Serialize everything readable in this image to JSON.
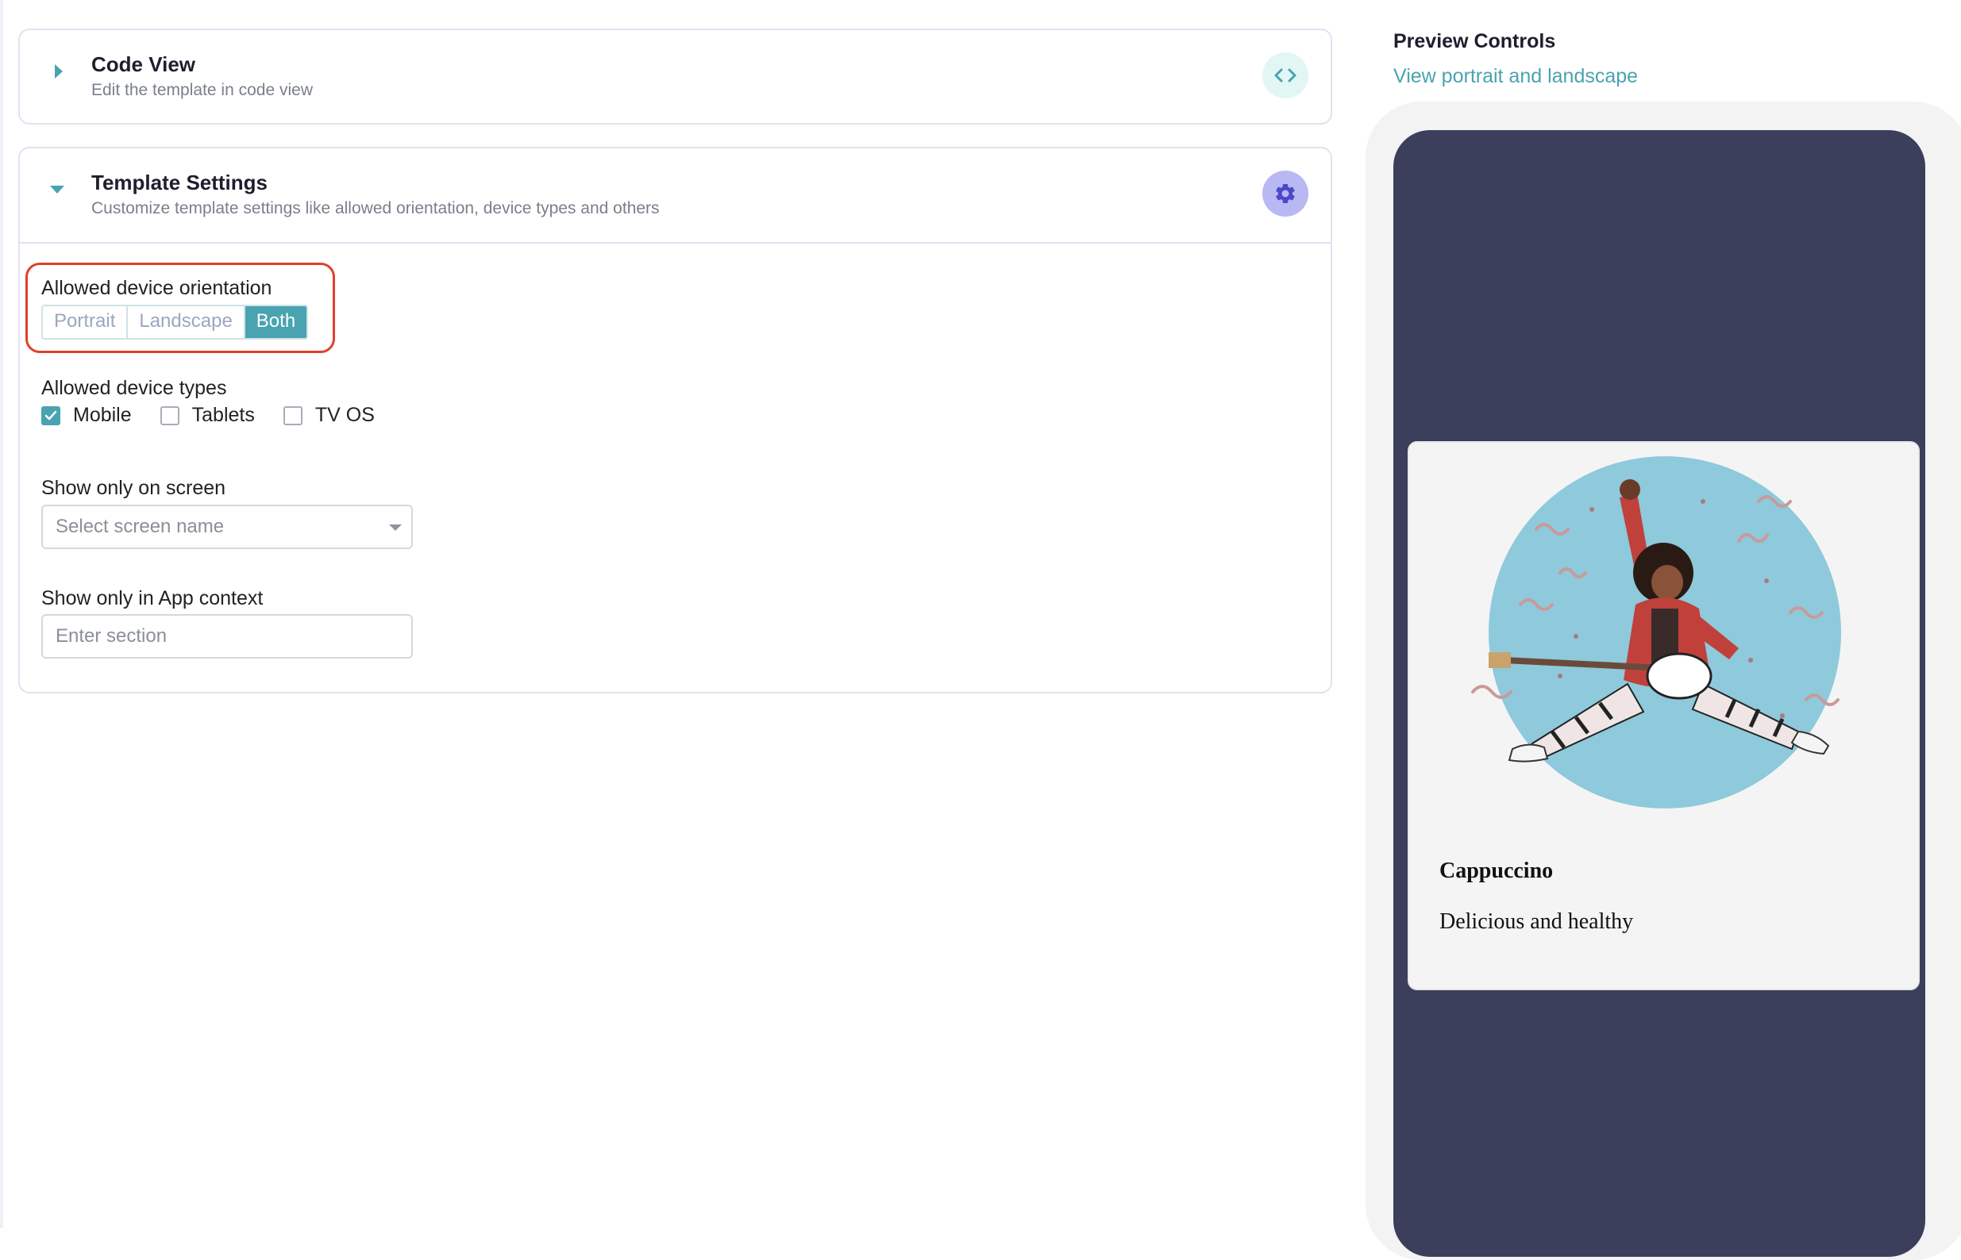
{
  "code_view": {
    "title": "Code View",
    "subtitle": "Edit the template in code view",
    "icon": "code-icon"
  },
  "template_settings": {
    "title": "Template Settings",
    "subtitle": "Customize template settings like allowed orientation, device types and others",
    "icon": "gear-icon",
    "orientation": {
      "label": "Allowed device orientation",
      "options": [
        "Portrait",
        "Landscape",
        "Both"
      ],
      "selected": "Both"
    },
    "device_types": {
      "label": "Allowed device types",
      "options": [
        {
          "label": "Mobile",
          "checked": true
        },
        {
          "label": "Tablets",
          "checked": false
        },
        {
          "label": "TV OS",
          "checked": false
        }
      ]
    },
    "screen": {
      "label": "Show only on screen",
      "placeholder": "Select screen name"
    },
    "app_context": {
      "label": "Show only in App context",
      "placeholder": "Enter section"
    }
  },
  "preview": {
    "title": "Preview Controls",
    "link": "View portrait and landscape",
    "card": {
      "title": "Cappuccino",
      "subtitle": "Delicious and healthy"
    }
  },
  "colors": {
    "accent": "#4aa3b0",
    "device_screen": "#3c3f5b",
    "highlight": "#e0402a"
  }
}
